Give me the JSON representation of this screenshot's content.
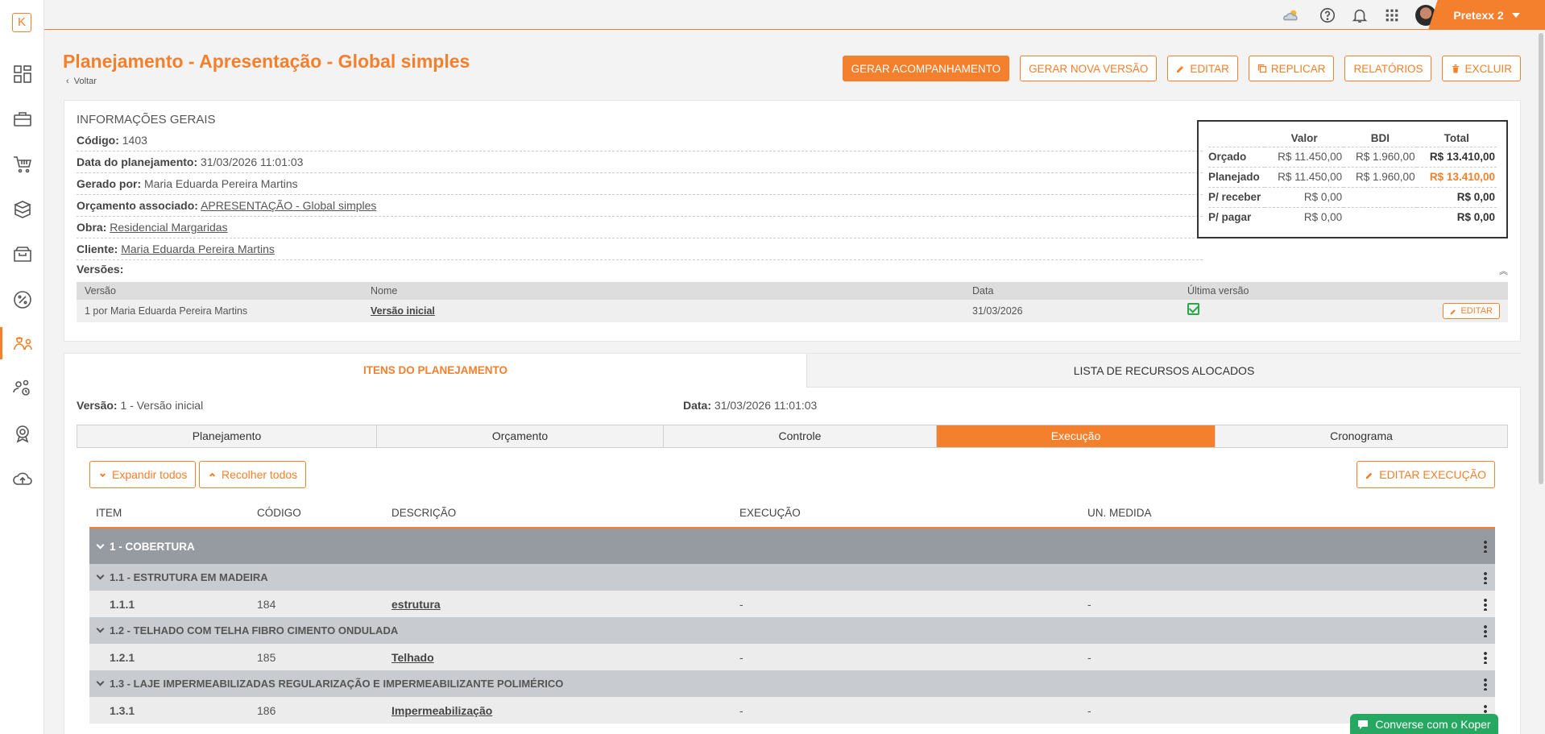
{
  "app": {
    "logo_letter": "K",
    "user_name": "Pretexx 2"
  },
  "colors": {
    "accent": "#f47f2c",
    "success": "#27a844",
    "chat": "#26a862"
  },
  "sidebar": {
    "items": [
      {
        "icon": "dashboard-icon"
      },
      {
        "icon": "briefcase-icon"
      },
      {
        "icon": "cart-icon"
      },
      {
        "icon": "boxes-icon"
      },
      {
        "icon": "folder-icon"
      },
      {
        "icon": "percent-icon"
      },
      {
        "icon": "engineer-icon",
        "active": true
      },
      {
        "icon": "people-search-icon"
      },
      {
        "icon": "award-icon"
      },
      {
        "icon": "cloud-upload-icon"
      }
    ]
  },
  "header": {
    "title": "Planejamento - Apresentação - Global simples",
    "back": "Voltar",
    "actions": {
      "generate_tracking": "GERAR ACOMPANHAMENTO",
      "new_version": "GERAR NOVA VERSÃO",
      "edit": "EDITAR",
      "replicate": "REPLICAR",
      "reports": "RELATÓRIOS",
      "delete": "EXCLUIR"
    }
  },
  "general_info": {
    "heading": "INFORMAÇÕES GERAIS",
    "code_label": "Código:",
    "code": "1403",
    "date_label": "Data do planejamento:",
    "date": "31/03/2026 11:01:03",
    "generated_by_label": "Gerado por:",
    "generated_by": "Maria Eduarda Pereira Martins",
    "budget_label": "Orçamento associado:",
    "budget": "APRESENTAÇÃO - Global simples",
    "work_label": "Obra:",
    "work": "Residencial Margaridas",
    "client_label": "Cliente:",
    "client": "Maria Eduarda Pereira Martins",
    "versions_label": "Versões:",
    "versions_table": {
      "headers": {
        "version": "Versão",
        "name": "Nome",
        "date": "Data",
        "latest": "Última versão"
      },
      "row": {
        "version": "1 por Maria Eduarda Pereira Martins",
        "name": "Versão inicial",
        "date": "31/03/2026",
        "edit": "EDITAR"
      }
    }
  },
  "summary": {
    "headers": {
      "value": "Valor",
      "bdi": "BDI",
      "total": "Total"
    },
    "rows": [
      {
        "label": "Orçado",
        "value": "R$ 11.450,00",
        "bdi": "R$ 1.960,00",
        "total": "R$ 13.410,00"
      },
      {
        "label": "Planejado",
        "value": "R$ 11.450,00",
        "bdi": "R$ 1.960,00",
        "total": "R$ 13.410,00"
      },
      {
        "label": "P/ receber",
        "value": "R$ 0,00",
        "bdi": "",
        "total": "R$ 0,00"
      },
      {
        "label": "P/ pagar",
        "value": "R$ 0,00",
        "bdi": "",
        "total": "R$ 0,00"
      }
    ]
  },
  "main": {
    "tabs": {
      "items": "ITENS DO PLANEJAMENTO",
      "resources": "LISTA DE RECURSOS ALOCADOS"
    },
    "version_label": "Versão:",
    "version": "1 - Versão inicial",
    "date_label": "Data:",
    "date": "31/03/2026 11:01:03",
    "subtabs": [
      "Planejamento",
      "Orçamento",
      "Controle",
      "Execução",
      "Cronograma"
    ],
    "active_subtab": "Execução",
    "expand_all": "Expandir todos",
    "collapse_all": "Recolher todos",
    "edit_execution": "EDITAR EXECUÇÃO",
    "columns": {
      "item": "ITEM",
      "code": "CÓDIGO",
      "description": "DESCRIÇÃO",
      "execution": "EXECUÇÃO",
      "unit": "UN. MEDIDA"
    },
    "rows": [
      {
        "level": 1,
        "label": "1 - COBERTURA"
      },
      {
        "level": 2,
        "label": "1.1 - ESTRUTURA EM MADEIRA"
      },
      {
        "level": 3,
        "item": "1.1.1",
        "code": "184",
        "description": "estrutura",
        "execution": "-",
        "unit": "-"
      },
      {
        "level": 2,
        "label": "1.2 - TELHADO COM TELHA FIBRO CIMENTO ONDULADA"
      },
      {
        "level": 3,
        "item": "1.2.1",
        "code": "185",
        "description": "Telhado",
        "execution": "-",
        "unit": "-"
      },
      {
        "level": 2,
        "label": "1.3 - LAJE IMPERMEABILIZADAS REGULARIZAÇÃO E IMPERMEABILIZANTE POLIMÉRICO"
      },
      {
        "level": 3,
        "item": "1.3.1",
        "code": "186",
        "description": "Impermeabilização",
        "execution": "-",
        "unit": "-"
      }
    ]
  },
  "chat": {
    "label": "Converse com o Koper"
  }
}
